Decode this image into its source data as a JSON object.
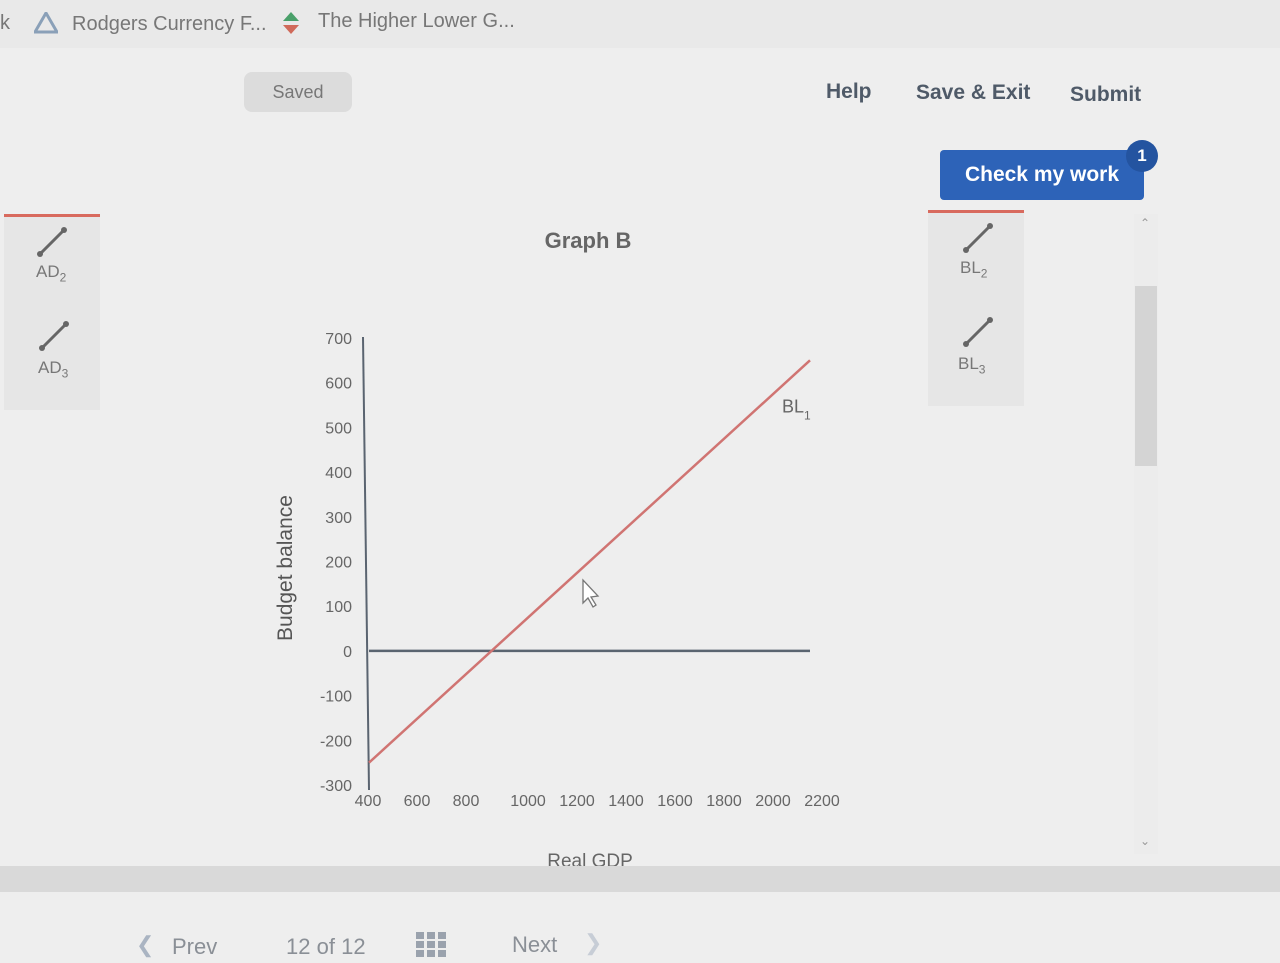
{
  "bookmarks": {
    "partial_left": "k",
    "item1": "Rodgers Currency F...",
    "item2": "The Higher Lower G..."
  },
  "header": {
    "saved": "Saved",
    "help": "Help",
    "save_exit": "Save & Exit",
    "submit": "Submit",
    "check_my_work": "Check my work",
    "check_badge": "1"
  },
  "left_palette": {
    "tools": [
      {
        "label": "AD",
        "sub": "2"
      },
      {
        "label": "AD",
        "sub": "3"
      }
    ]
  },
  "right_palette": {
    "tools": [
      {
        "label": "BL",
        "sub": "2"
      },
      {
        "label": "BL",
        "sub": "3"
      }
    ]
  },
  "chart_data": {
    "type": "line",
    "title": "Graph B",
    "xlabel": "Real GDP",
    "ylabel": "Budget balance",
    "xlim": [
      400,
      2200
    ],
    "ylim": [
      -300,
      700
    ],
    "x_ticks": [
      400,
      600,
      800,
      1000,
      1200,
      1400,
      1600,
      1800,
      2000,
      2200
    ],
    "y_ticks": [
      700,
      600,
      500,
      400,
      300,
      200,
      100,
      0,
      -100,
      -200,
      -300
    ],
    "grid": false,
    "series": [
      {
        "name": "BL1",
        "label_main": "BL",
        "label_sub": "1",
        "x": [
          400,
          2200
        ],
        "y": [
          -250,
          650
        ],
        "color": "#d07472"
      }
    ],
    "zero_line": {
      "y": 0,
      "color": "#5a6470"
    }
  },
  "footer": {
    "prev": "Prev",
    "page_current": "12",
    "page_of": "of",
    "page_total": "12",
    "next": "Next"
  },
  "colors": {
    "accent_blue": "#2d63b8",
    "line_red": "#d07472",
    "header_text": "#4f5a68"
  }
}
